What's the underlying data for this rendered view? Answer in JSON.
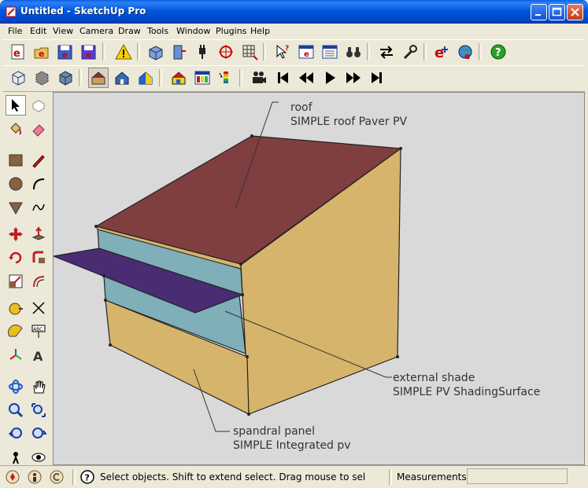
{
  "window": {
    "title": "Untitled - SketchUp Pro"
  },
  "menu": [
    "File",
    "Edit",
    "View",
    "Camera",
    "Draw",
    "Tools",
    "Window",
    "Plugins",
    "Help"
  ],
  "annotations": {
    "roof": {
      "line1": "roof",
      "line2": "SIMPLE roof Paver PV"
    },
    "shade": {
      "line1": "external shade",
      "line2": "SIMPLE PV ShadingSurface"
    },
    "spandral": {
      "line1": "spandral panel",
      "line2": "SIMPLE Integrated pv"
    }
  },
  "status": {
    "message": "Select objects. Shift to extend select. Drag mouse to sel",
    "measurements_label": "Measurements",
    "measurements_value": ""
  },
  "colors": {
    "roof": "#7f3f41",
    "wall": "#d6b46b",
    "glass": "#7fafb8",
    "shade": "#4a2c73",
    "background": "#d9d9d9"
  }
}
